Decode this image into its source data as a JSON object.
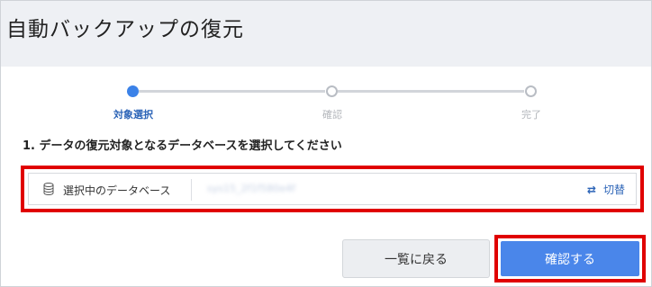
{
  "page": {
    "title": "自動バックアップの復元"
  },
  "stepper": {
    "steps": [
      {
        "label": "対象選択",
        "state": "active"
      },
      {
        "label": "確認",
        "state": "inactive"
      },
      {
        "label": "完了",
        "state": "inactive"
      }
    ]
  },
  "instruction": "1. データの復元対象となるデータベースを選択してください",
  "database": {
    "label": "選択中のデータベース",
    "selected_value": "sys15_2f1f580e4f",
    "switch_label": "切替",
    "icon": "database-icon",
    "switch_icon": "swap-arrows-icon"
  },
  "actions": {
    "back_label": "一覧に戻る",
    "confirm_label": "確認する"
  },
  "colors": {
    "accent": "#3b82e8",
    "highlight_outline": "#e00000",
    "header_bg": "#eef0f4"
  }
}
